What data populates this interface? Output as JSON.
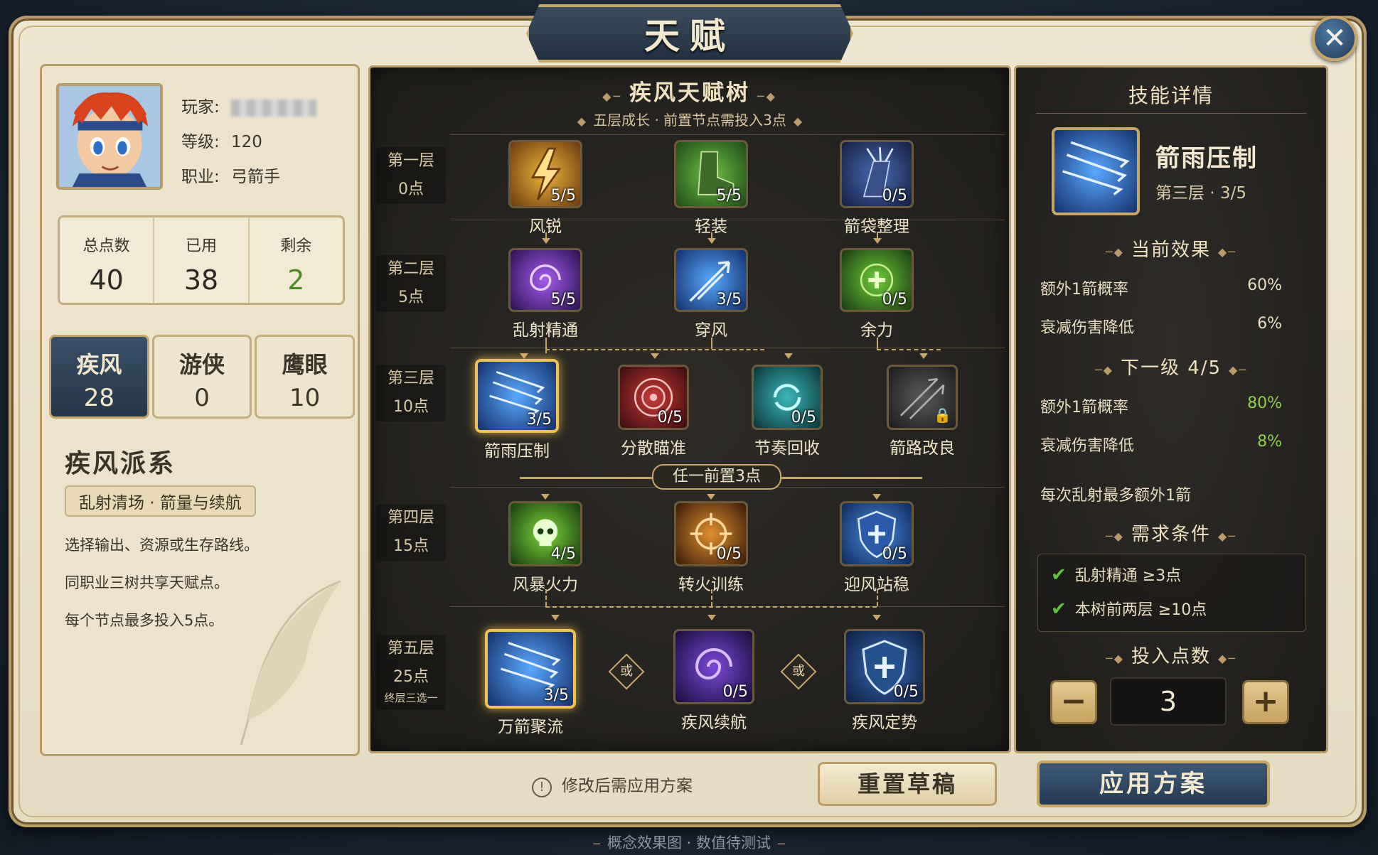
{
  "title": "天赋",
  "player": {
    "name_label": "玩家:",
    "level_label": "等级:",
    "level": "120",
    "class_label": "职业:",
    "class": "弓箭手"
  },
  "stats": [
    {
      "label": "总点数",
      "value": "40"
    },
    {
      "label": "已用",
      "value": "38"
    },
    {
      "label": "剩余",
      "value": "2"
    }
  ],
  "trees": [
    {
      "name": "疾风",
      "points": "28"
    },
    {
      "name": "游侠",
      "points": "0"
    },
    {
      "name": "鹰眼",
      "points": "10"
    }
  ],
  "school": {
    "title": "疾风派系",
    "badge": "乱射清场 · 箭量与续航",
    "lines": [
      "选择输出、资源或生存路线。",
      "同职业三树共享天赋点。",
      "每个节点最多投入5点。"
    ]
  },
  "tree": {
    "title": "疾风天赋树",
    "subtitle": "五层成长 · 前置节点需投入3点",
    "requirement": "任一前置3点",
    "or_label": "或",
    "tiers": [
      {
        "name": "第一层",
        "points": "0点"
      },
      {
        "name": "第二层",
        "points": "5点"
      },
      {
        "name": "第三层",
        "points": "10点"
      },
      {
        "name": "第四层",
        "points": "15点"
      },
      {
        "name": "第五层",
        "points": "25点",
        "note": "终层三选一"
      }
    ],
    "nodes": [
      {
        "name": "风锐",
        "count": "5/5",
        "icon": "lightning-icon"
      },
      {
        "name": "轻装",
        "count": "5/5",
        "icon": "boot-icon"
      },
      {
        "name": "箭袋整理",
        "count": "0/5",
        "icon": "quiver-icon"
      },
      {
        "name": "乱射精通",
        "count": "5/5",
        "icon": "vortex-icon"
      },
      {
        "name": "穿风",
        "count": "3/5",
        "icon": "arrow-icon"
      },
      {
        "name": "余力",
        "count": "0/5",
        "icon": "plus-icon"
      },
      {
        "name": "箭雨压制",
        "count": "3/5",
        "icon": "arrow-rain-icon"
      },
      {
        "name": "分散瞄准",
        "count": "0/5",
        "icon": "target-icon"
      },
      {
        "name": "节奏回收",
        "count": "0/5",
        "icon": "recycle-icon"
      },
      {
        "name": "箭路改良",
        "count": "",
        "icon": "locked-arrows-icon"
      },
      {
        "name": "风暴火力",
        "count": "4/5",
        "icon": "skull-icon"
      },
      {
        "name": "转火训练",
        "count": "0/5",
        "icon": "crosshair-icon"
      },
      {
        "name": "迎风站稳",
        "count": "0/5",
        "icon": "shield-icon"
      },
      {
        "name": "万箭聚流",
        "count": "3/5",
        "icon": "arrow-rain-icon"
      },
      {
        "name": "疾风续航",
        "count": "0/5",
        "icon": "swirl-icon"
      },
      {
        "name": "疾风定势",
        "count": "0/5",
        "icon": "shield-swirl-icon"
      }
    ]
  },
  "detail": {
    "header": "技能详情",
    "name": "箭雨压制",
    "tier": "第三层 · 3/5",
    "current_title": "当前效果",
    "current": [
      {
        "k": "额外1箭概率",
        "v": "60%"
      },
      {
        "k": "衰减伤害降低",
        "v": "6%"
      }
    ],
    "next_title": "下一级  4/5",
    "next": [
      {
        "k": "额外1箭概率",
        "v": "80%"
      },
      {
        "k": "衰减伤害降低",
        "v": "8%"
      }
    ],
    "note": "每次乱射最多额外1箭",
    "req_title": "需求条件",
    "reqs": [
      "乱射精通 ≥3点",
      "本树前两层 ≥10点"
    ],
    "invest_title": "投入点数",
    "invest_value": "3",
    "minus": "−",
    "plus": "+"
  },
  "bottom": {
    "warning": "修改后需应用方案",
    "reset": "重置草稿",
    "apply": "应用方案",
    "footer": "概念效果图 · 数值待测试"
  },
  "colors": {
    "accent_gold": "#c8a66a",
    "navy": "#2a3d52",
    "green": "#8dd14a"
  }
}
